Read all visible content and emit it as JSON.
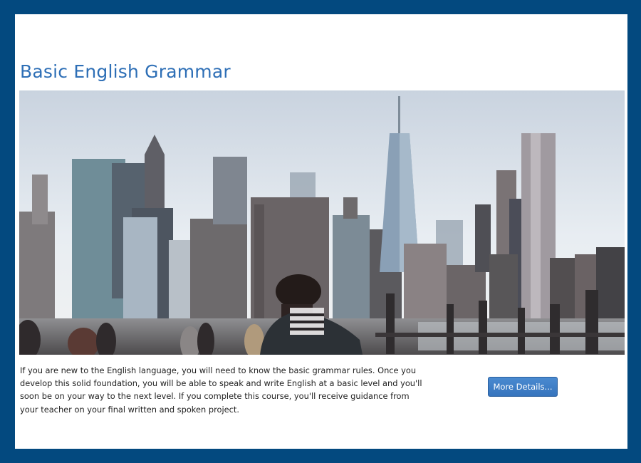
{
  "course": {
    "title": "Basic English Grammar",
    "description": "If you are new to the English language, you will need to know the basic grammar rules. Once you develop this solid foundation, you will be able to speak and write English at a basic level and you'll soon be on your way to the next level. If you complete this course, you'll receive guidance from your teacher on your final written and spoken project.",
    "more_button_label": "More Details..."
  },
  "colors": {
    "border": "#03497f",
    "title": "#2e6fb6",
    "button": "#3a7bc4"
  }
}
